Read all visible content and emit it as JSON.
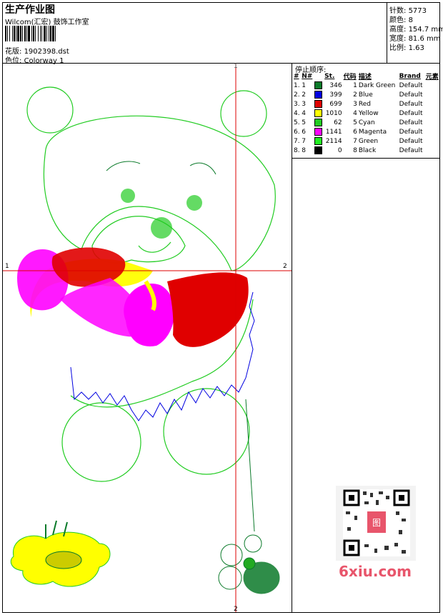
{
  "header": {
    "title": "生产作业图",
    "company": "Wilcom(汇宏) 鼓饰工作室",
    "design_label": "花版:",
    "design_file": "1902398.dst",
    "colorway_label": "色位:",
    "colorway": "Colorway 1"
  },
  "stats": {
    "stitches_label": "针数:",
    "stitches": "5773",
    "colors_label": "颜色:",
    "colors": "8",
    "height_label": "高度:",
    "height": "154.7 mm",
    "width_label": "宽度:",
    "width": "81.6 mm",
    "scale_label": "比例:",
    "scale": "1.63"
  },
  "stop_sequence": {
    "heading": "停止顺序:",
    "columns": [
      "#",
      "N#",
      "St.",
      "代码",
      "描述",
      "Brand",
      "元素"
    ],
    "rows": [
      {
        "idx": "1.",
        "n": "1",
        "color": "#0b7a2a",
        "st": "346",
        "code": "1",
        "desc": "Dark Green",
        "brand": "Default"
      },
      {
        "idx": "2.",
        "n": "2",
        "color": "#0000e0",
        "st": "399",
        "code": "2",
        "desc": "Blue",
        "brand": "Default"
      },
      {
        "idx": "3.",
        "n": "3",
        "color": "#e00000",
        "st": "699",
        "code": "3",
        "desc": "Red",
        "brand": "Default"
      },
      {
        "idx": "4.",
        "n": "4",
        "color": "#ffff00",
        "st": "1010",
        "code": "4",
        "desc": "Yellow",
        "brand": "Default"
      },
      {
        "idx": "5.",
        "n": "5",
        "color": "#22cc22",
        "st": "62",
        "code": "5",
        "desc": "Cyan",
        "brand": "Default"
      },
      {
        "idx": "6.",
        "n": "6",
        "color": "#ff00ff",
        "st": "1141",
        "code": "6",
        "desc": "Magenta",
        "brand": "Default"
      },
      {
        "idx": "7.",
        "n": "7",
        "color": "#22ee22",
        "st": "2114",
        "code": "7",
        "desc": "Green",
        "brand": "Default"
      },
      {
        "idx": "8.",
        "n": "8",
        "color": "#000000",
        "st": "0",
        "code": "8",
        "desc": "Black",
        "brand": "Default"
      }
    ]
  },
  "guides": {
    "top": "1",
    "bottom": "2",
    "left": "1",
    "right": "2"
  },
  "watermark": {
    "site": "6xiu.com",
    "stamp": "图"
  },
  "colors": {
    "guide": "#dd0000",
    "outline": "#22cc22",
    "red": "#e00000",
    "magenta": "#ff00ff",
    "yellow": "#ffff00",
    "blue": "#0000e0",
    "dark_green": "#0b7a2a",
    "watermark": "#e8556b"
  }
}
